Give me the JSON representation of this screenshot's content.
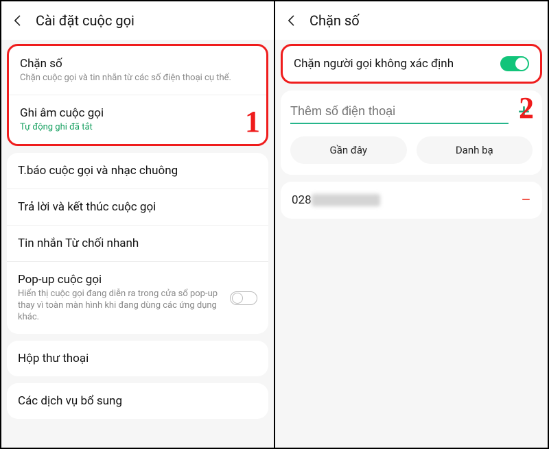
{
  "left": {
    "header_title": "Cài đặt cuộc gọi",
    "group1": [
      {
        "title": "Chặn số",
        "sub": "Chặn cuộc gọi và tin nhắn từ các số điện thoại cụ thể."
      },
      {
        "title": "Ghi âm cuộc gọi",
        "sub": "Tự động ghi đã tắt"
      }
    ],
    "group2": [
      {
        "title": "T.báo cuộc gọi và nhạc chuông"
      },
      {
        "title": "Trả lời và kết thúc cuộc gọi"
      },
      {
        "title": "Tin nhắn Từ chối nhanh"
      },
      {
        "title": "Pop-up cuộc gọi",
        "sub": "Hiển thị cuộc gọi đang diễn ra trong cửa sổ pop-up thay vì toàn màn hình khi đang dùng các ứng dụng khác."
      }
    ],
    "group3": [
      {
        "title": "Hộp thư thoại"
      }
    ],
    "group4": [
      {
        "title": "Các dịch vụ bổ sung"
      }
    ],
    "step_number": "1"
  },
  "right": {
    "header_title": "Chặn số",
    "block_unknown_label": "Chặn người gọi không xác định",
    "add_phone_placeholder": "Thêm số điện thoại",
    "chip_recent": "Gần đây",
    "chip_contacts": "Danh bạ",
    "blocked_prefix": "028",
    "step_number": "2"
  }
}
